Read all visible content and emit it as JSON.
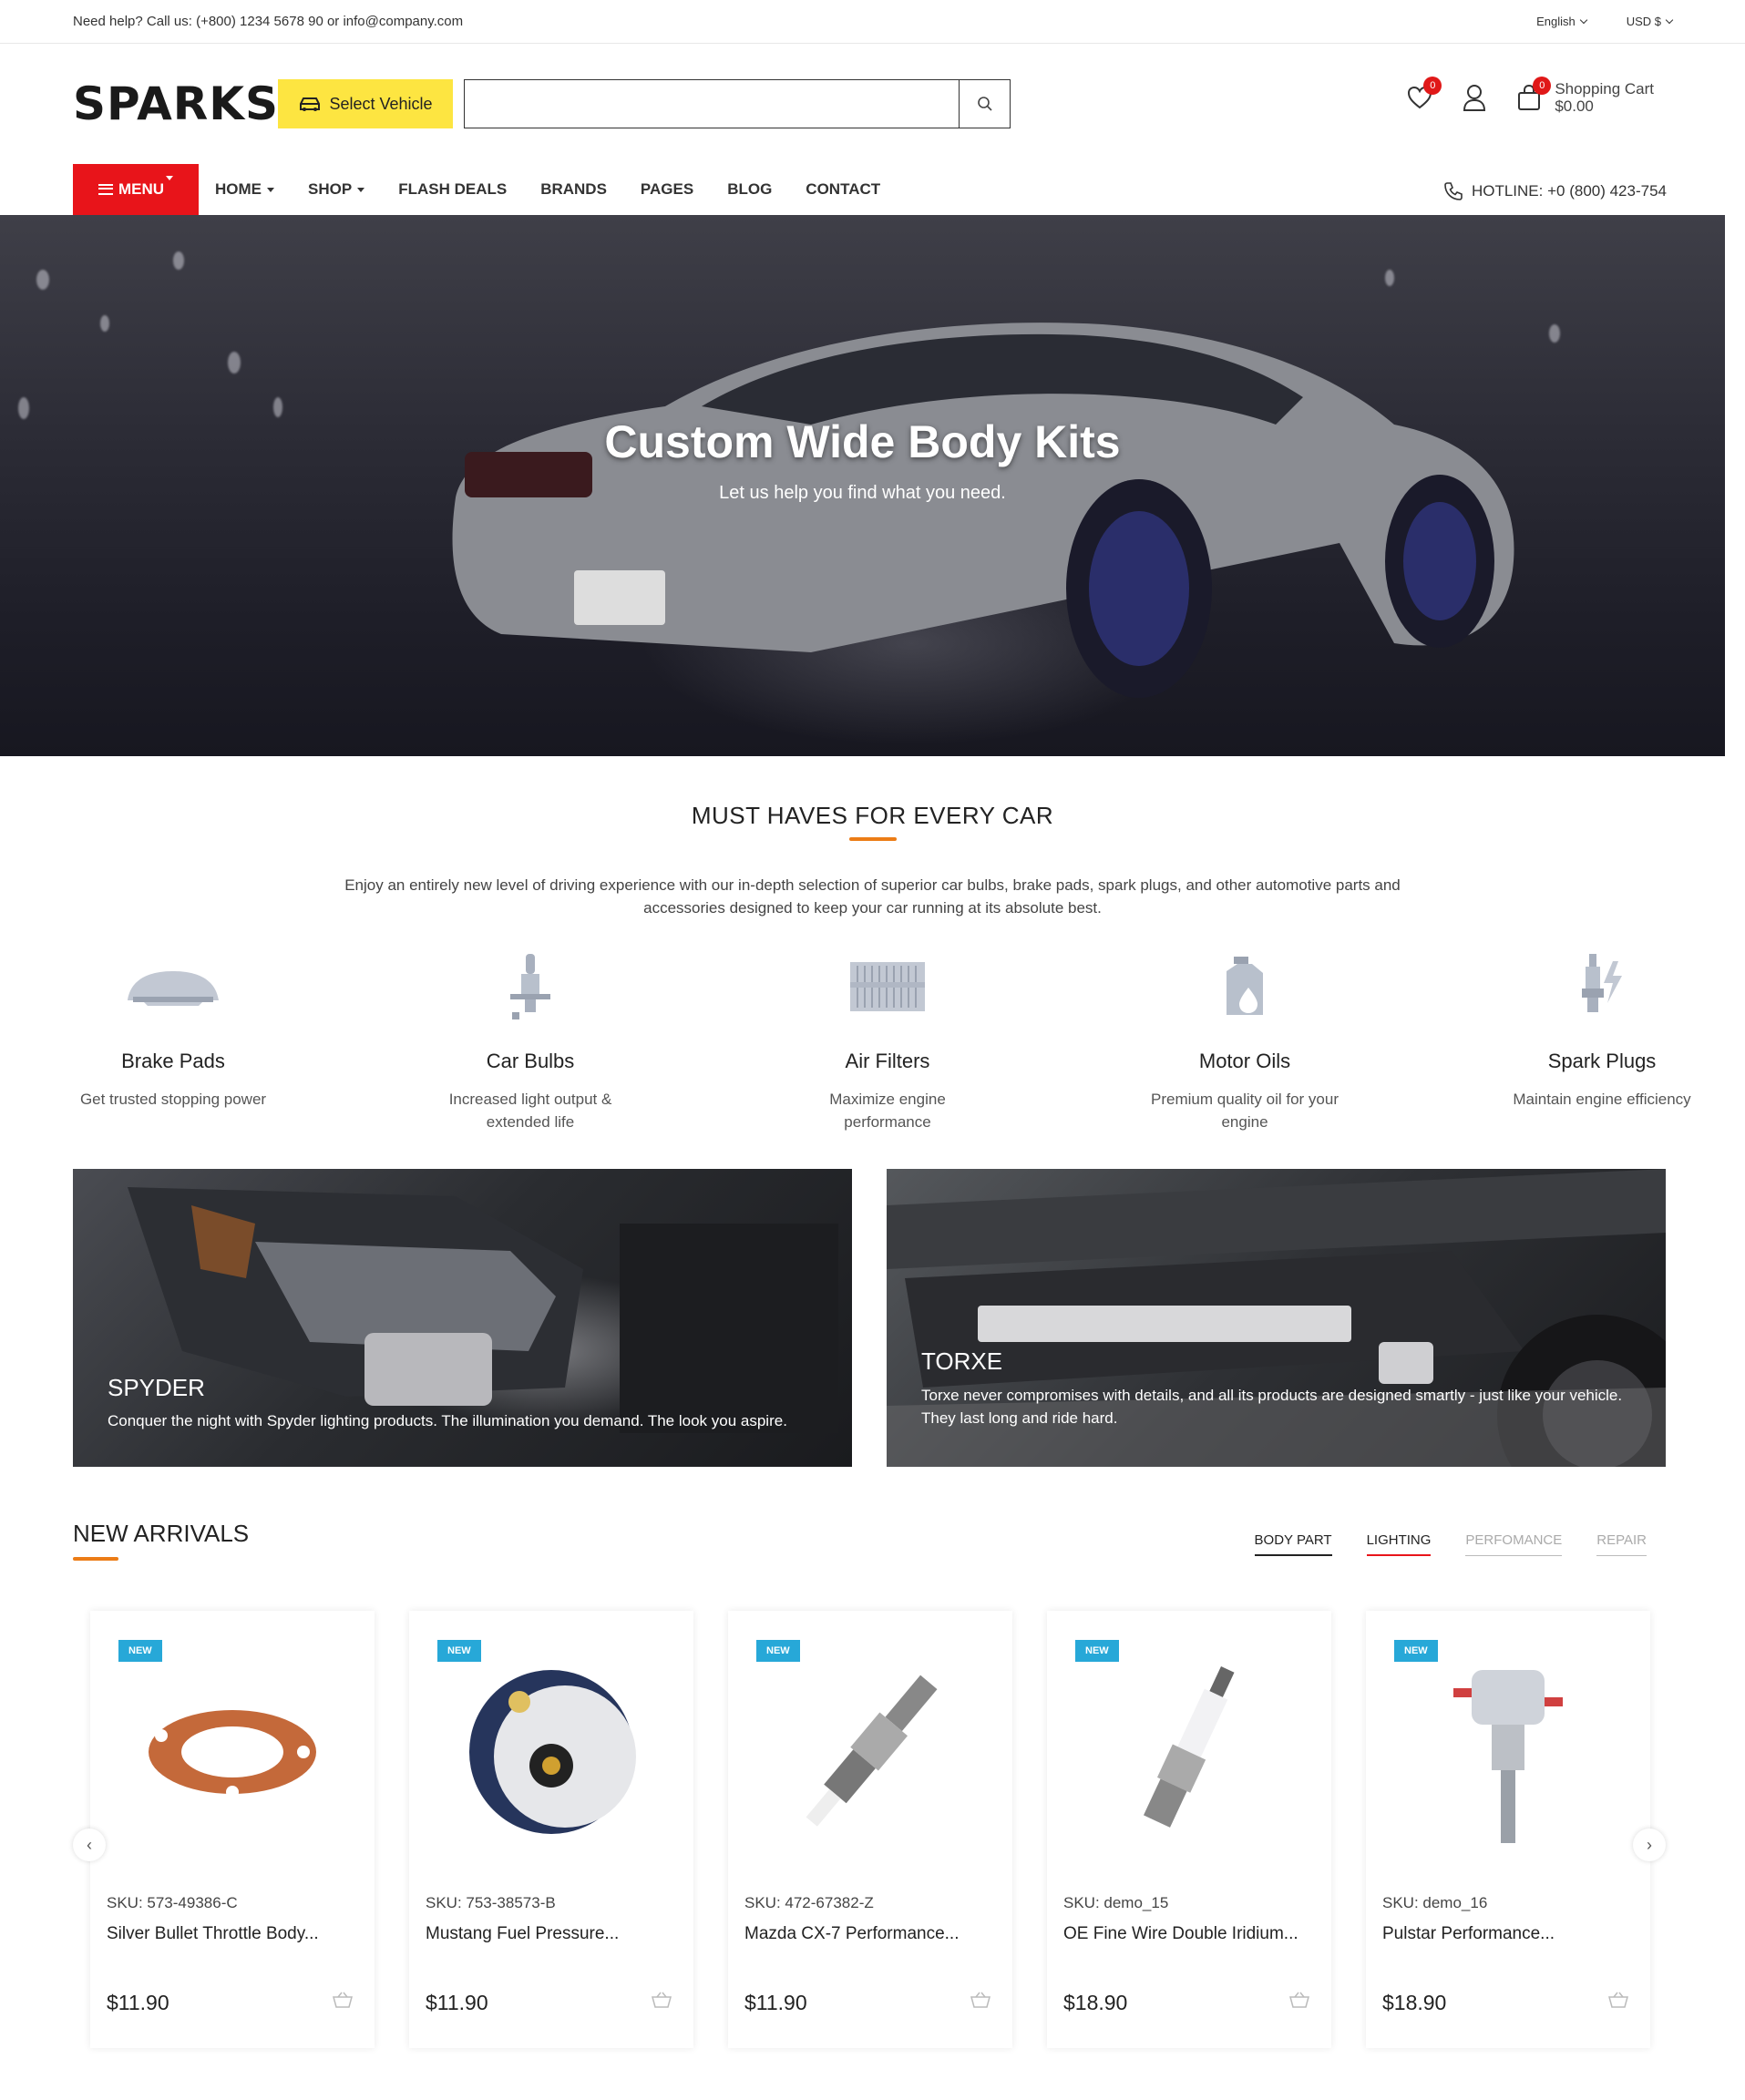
{
  "topbar": {
    "help": "Need help? Call us: (+800) 1234 5678 90 or info@company.com",
    "language": "English",
    "currency": "USD $"
  },
  "header": {
    "logo": "SPARKS",
    "select_vehicle": "Select Vehicle",
    "search_placeholder": "",
    "wishlist_count": "0",
    "cart_count": "0",
    "cart_label": "Shopping Cart",
    "cart_total": "$0.00"
  },
  "nav": {
    "menu": "MENU",
    "links": [
      "HOME",
      "SHOP",
      "FLASH DEALS",
      "BRANDS",
      "PAGES",
      "BLOG",
      "CONTACT"
    ],
    "hotline": "HOTLINE: +0 (800) 423-754"
  },
  "hero": {
    "title": "Custom Wide Body Kits",
    "subtitle": "Let us help you find what you need."
  },
  "must_haves": {
    "title": "MUST HAVES FOR EVERY CAR",
    "intro": "Enjoy an entirely new level of driving experience with our in-depth selection of superior car bulbs, brake pads, spark plugs, and other automotive parts and accessories designed to keep your car running at its absolute best.",
    "items": [
      {
        "title": "Brake Pads",
        "desc": "Get trusted stopping power",
        "icon": "brake-pad-icon"
      },
      {
        "title": "Car Bulbs",
        "desc": "Increased light output & extended life",
        "icon": "bulb-icon"
      },
      {
        "title": "Air Filters",
        "desc": "Maximize engine performance",
        "icon": "air-filter-icon"
      },
      {
        "title": "Motor Oils",
        "desc": "Premium quality oil for your engine",
        "icon": "oil-icon"
      },
      {
        "title": "Spark Plugs",
        "desc": "Maintain engine efficiency",
        "icon": "spark-plug-icon"
      }
    ]
  },
  "banners": [
    {
      "title": "SPYDER",
      "text": "Conquer the night with Spyder lighting products. The illumination you demand. The look you aspire."
    },
    {
      "title": "TORXE",
      "text": "Torxe never compromises with details, and all its products are designed smartly - just like your vehicle. They last long and ride hard."
    }
  ],
  "arrivals": {
    "title": "NEW ARRIVALS",
    "tabs": [
      "BODY PART",
      "LIGHTING",
      "PERFOMANCE",
      "REPAIR"
    ],
    "products": [
      {
        "badge": "NEW",
        "sku": "SKU: 573-49386-C",
        "name": "Silver Bullet Throttle Body...",
        "price": "$11.90"
      },
      {
        "badge": "NEW",
        "sku": "SKU: 753-38573-B",
        "name": "Mustang Fuel Pressure...",
        "price": "$11.90"
      },
      {
        "badge": "NEW",
        "sku": "SKU: 472-67382-Z",
        "name": "Mazda CX-7 Performance...",
        "price": "$11.90"
      },
      {
        "badge": "NEW",
        "sku": "SKU: demo_15",
        "name": "OE Fine Wire Double Iridium...",
        "price": "$18.90"
      },
      {
        "badge": "NEW",
        "sku": "SKU: demo_16",
        "name": "Pulstar Performance...",
        "price": "$18.90"
      }
    ]
  },
  "colors": {
    "menu_red": "#e8141a",
    "select_yellow": "#fde541",
    "accent_orange": "#ec7c16",
    "badge_blue": "#27a8d8"
  }
}
